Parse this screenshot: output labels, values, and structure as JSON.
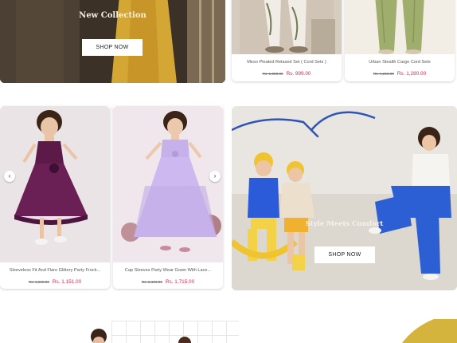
{
  "hero_banner": {
    "title": "New Collection",
    "button_label": "SHOP NOW"
  },
  "products_row1": [
    {
      "title": "Meso Pleated Relaxed Set ( Cord Sets )",
      "old_price": "Rs. 1,000.00",
      "price": "Rs. 999.00"
    },
    {
      "title": "Urban Stealth Cargo Cord Sets",
      "old_price": "Rs. 1,299.00",
      "price": "Rs. 1,280.00"
    }
  ],
  "products_row2": [
    {
      "title": "Sleeveless Fit And Flare Glittery Party Frock...",
      "old_price": "Rs. 1,599.00",
      "price": "Rs. 1,151.00"
    },
    {
      "title": "Cap Sleeves Party Wear Gown With Lace...",
      "old_price": "Rs. 2,199.00",
      "price": "Rs. 1,715.00"
    }
  ],
  "carousel": {
    "prev_icon": "chevron-left-icon",
    "next_icon": "chevron-right-icon",
    "prev_glyph": "‹",
    "next_glyph": "›"
  },
  "kids_banner": {
    "title": "Style Meets Comfort",
    "button_label": "SHOP NOW"
  },
  "colors": {
    "sale_price": "#e0284c",
    "accent_yellow": "#d4b43c"
  }
}
